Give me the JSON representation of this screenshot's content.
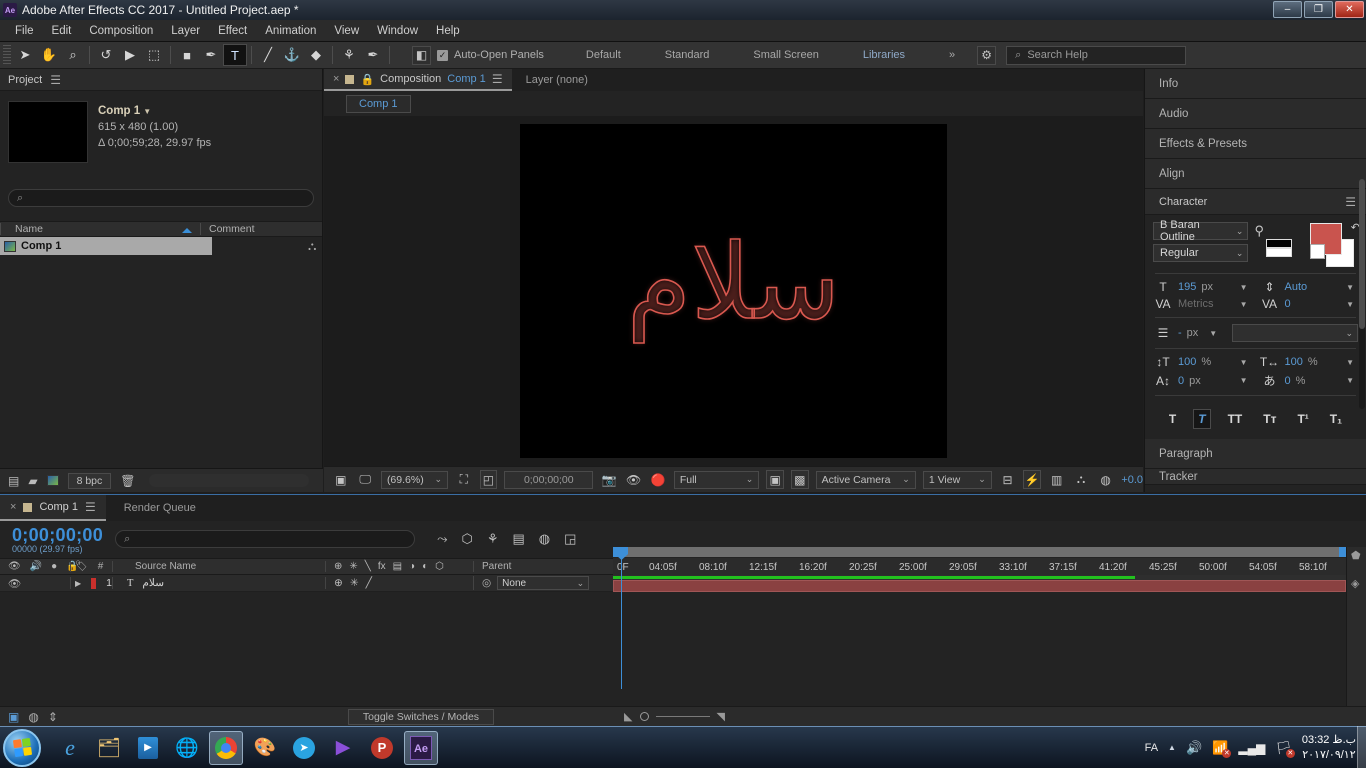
{
  "titlebar": {
    "app_badge": "Ae",
    "title": "Adobe After Effects CC 2017 - Untitled Project.aep *",
    "minimize": "–",
    "maximize": "❐",
    "close": "✕"
  },
  "menubar": {
    "items": [
      "File",
      "Edit",
      "Composition",
      "Layer",
      "Effect",
      "Animation",
      "View",
      "Window",
      "Help"
    ]
  },
  "toolbar": {
    "tools": [
      {
        "name": "selection-tool",
        "glyph": "➤",
        "active": false
      },
      {
        "name": "hand-tool",
        "glyph": "✋",
        "active": false
      },
      {
        "name": "zoom-tool",
        "glyph": "⌕",
        "active": false
      },
      {
        "name": "rotation-tool",
        "glyph": "↺",
        "active": false
      },
      {
        "name": "camera-tool",
        "glyph": "▶",
        "active": false
      },
      {
        "name": "pan-behind-tool",
        "glyph": "⬚",
        "active": false
      },
      {
        "name": "shape-tool",
        "glyph": "■",
        "active": false
      },
      {
        "name": "pen-tool",
        "glyph": "✒",
        "active": false
      },
      {
        "name": "type-tool",
        "glyph": "T",
        "active": true
      },
      {
        "name": "brush-tool",
        "glyph": "╱",
        "active": false
      },
      {
        "name": "clone-stamp-tool",
        "glyph": "⚓",
        "active": false
      },
      {
        "name": "eraser-tool",
        "glyph": "◆",
        "active": false
      },
      {
        "name": "roto-brush-tool",
        "glyph": "⚘",
        "active": false
      },
      {
        "name": "puppet-pin-tool",
        "glyph": "✒",
        "active": false
      }
    ],
    "auto_open_label": "Auto-Open Panels",
    "auto_open_checked": "✓",
    "workspaces": [
      "Default",
      "Standard",
      "Small Screen",
      "Libraries"
    ],
    "overflow": "»",
    "sync_settings_icon": "sync-settings-icon",
    "search_help_placeholder": "Search Help"
  },
  "project": {
    "title": "Project",
    "menu_icon": "☰",
    "comp_name": "Comp 1",
    "comp_caret": "▼",
    "dimensions": "615 x 480 (1.00)",
    "duration": "Δ 0;00;59;28, 29.97 fps",
    "search_icon": "⌕",
    "search_placeholder": "",
    "columns": {
      "name": "Name",
      "comment": "Comment"
    },
    "rows": [
      {
        "name": "Comp 1",
        "icon": "comp-icon"
      }
    ],
    "footer": {
      "new_folder_icon": "new-folder-icon",
      "new_comp_icon": "new-comp-icon",
      "color_depth": "8 bpc",
      "delete_icon": "🗑"
    }
  },
  "composition": {
    "tab_close": "×",
    "tab_label": "Composition",
    "tab_comp_name": "Comp 1",
    "tab_menu": "☰",
    "layer_tab": "Layer (none)",
    "lock_icon": "🔒",
    "subtab": "Comp 1",
    "canvas_text": "سلام",
    "canvas_text_color": "#d9584f",
    "canvas_bg": "#000000",
    "footer": {
      "always_preview_icon": "always-preview-icon",
      "main_viewer_icon": "main-viewer-icon",
      "magnification": "(69.6%)",
      "region_of_interest_icon": "roi-icon",
      "grid_icon": "grid-guides-icon",
      "current_time": "0;00;00;00",
      "snapshot_icon": "📷",
      "show_snapshot_icon": "show-snapshot-icon",
      "channels_icon": "channels-icon",
      "resolution": "Full",
      "mask_icon": "mask-icon",
      "transparency_icon": "transparency-grid-icon",
      "camera_view": "Active Camera",
      "view_layout": "1 View",
      "pixel_aspect_icon": "pixel-aspect-icon",
      "fast_preview_icon": "fast-preview-icon",
      "timeline_icon": "timeline-icon",
      "flowchart_icon": "flowchart-icon",
      "exposure_icon": "exposure-icon",
      "exposure_value": "+0.0"
    }
  },
  "right_dock": {
    "panels": [
      "Info",
      "Audio",
      "Effects & Presets",
      "Align"
    ],
    "character": {
      "title": "Character",
      "menu_icon": "☰",
      "font_family": "B Baran Outline",
      "font_style": "Regular",
      "eyedropper_icon": "eyedropper-icon",
      "swap_icon": "↶",
      "fill_color": "#c9544e",
      "stroke_color": "#ffffff",
      "font_size": "195",
      "font_size_unit": "px",
      "leading": "Auto",
      "kerning": "Metrics",
      "tracking": "0",
      "stroke_width": "-",
      "stroke_width_unit": "px",
      "stroke_over_fill": "",
      "vertical_scale": "100",
      "vertical_scale_unit": "%",
      "horizontal_scale": "100",
      "horizontal_scale_unit": "%",
      "baseline_shift": "0",
      "baseline_shift_unit": "px",
      "tsume": "0",
      "tsume_unit": "%",
      "styles": [
        {
          "name": "faux-bold-button",
          "label": "T",
          "active": false
        },
        {
          "name": "faux-italic-button",
          "label": "T",
          "active": true
        },
        {
          "name": "all-caps-button",
          "label": "TT",
          "active": false
        },
        {
          "name": "small-caps-button",
          "label": "Tᴛ",
          "active": false
        },
        {
          "name": "superscript-button",
          "label": "T¹",
          "active": false
        },
        {
          "name": "subscript-button",
          "label": "T₁",
          "active": false
        }
      ]
    },
    "panels_below": [
      "Paragraph",
      "Tracker"
    ]
  },
  "timeline": {
    "tab_close": "×",
    "tab_label": "Comp 1",
    "tab_menu": "☰",
    "render_queue_tab": "Render Queue",
    "current_time": "0;00;00;00",
    "frame_readout": "00000 (29.97 fps)",
    "search_icon": "⌕",
    "toolbar_icons": [
      "composition-mini-flowchart-icon",
      "draft-3d-icon",
      "hide-shy-layers-icon",
      "frame-blending-icon",
      "motion-blur-icon",
      "graph-editor-icon"
    ],
    "columns": {
      "video": "👁",
      "audio": "🔊",
      "solo": "●",
      "lock": "🔒",
      "label": "🏷",
      "number": "#",
      "source_name": "Source Name",
      "switches": [
        "⊕",
        "✳",
        "╲",
        "fx",
        "▤",
        "◑",
        "◐",
        "⬡"
      ],
      "parent": "Parent"
    },
    "layers": [
      {
        "index": "1",
        "type_icon": "T",
        "source_name": "سلام",
        "label_color": "#c9302c",
        "parent": "None",
        "visible": true,
        "bar_color": "#8a4141"
      }
    ],
    "ruler_ticks": [
      "0F",
      "04:05f",
      "08:10f",
      "12:15f",
      "16:20f",
      "20:25f",
      "25:00f",
      "29:05f",
      "33:10f",
      "37:15f",
      "41:20f",
      "45:25f",
      "50:00f",
      "54:05f",
      "58:10f"
    ],
    "footer": {
      "toggle_switches": "Toggle Switches / Modes",
      "zoom_out_icon": "zoom-out-icon",
      "zoom_in_icon": "zoom-in-icon"
    }
  },
  "taskbar": {
    "start_icon": "windows-start-icon",
    "items": [
      {
        "name": "internet-explorer-icon",
        "glyph": "e",
        "running": false
      },
      {
        "name": "file-explorer-icon",
        "glyph": "🗂",
        "running": false
      },
      {
        "name": "windows-media-player-icon",
        "glyph": "▶",
        "running": false
      },
      {
        "name": "internet-download-manager-icon",
        "glyph": "⬇",
        "running": false
      },
      {
        "name": "google-chrome-icon",
        "glyph": "●",
        "running": true
      },
      {
        "name": "paint-icon",
        "glyph": "🎨",
        "running": false
      },
      {
        "name": "telegram-icon",
        "glyph": "➤",
        "running": false
      },
      {
        "name": "media-player-classic-icon",
        "glyph": "▶",
        "running": false
      },
      {
        "name": "potplayer-icon",
        "glyph": "P",
        "running": false
      },
      {
        "name": "after-effects-icon",
        "glyph": "Ae",
        "running": true
      }
    ],
    "tray": {
      "language": "FA",
      "show_hidden": "▲",
      "volume_icon": "volume-icon",
      "network_icon": "network-error-icon",
      "signal_icon": "signal-icon",
      "action_center_icon": "action-center-icon",
      "time": "ب.ظ 03:32",
      "date": "۲۰۱۷/۰۹/۱۲"
    }
  }
}
